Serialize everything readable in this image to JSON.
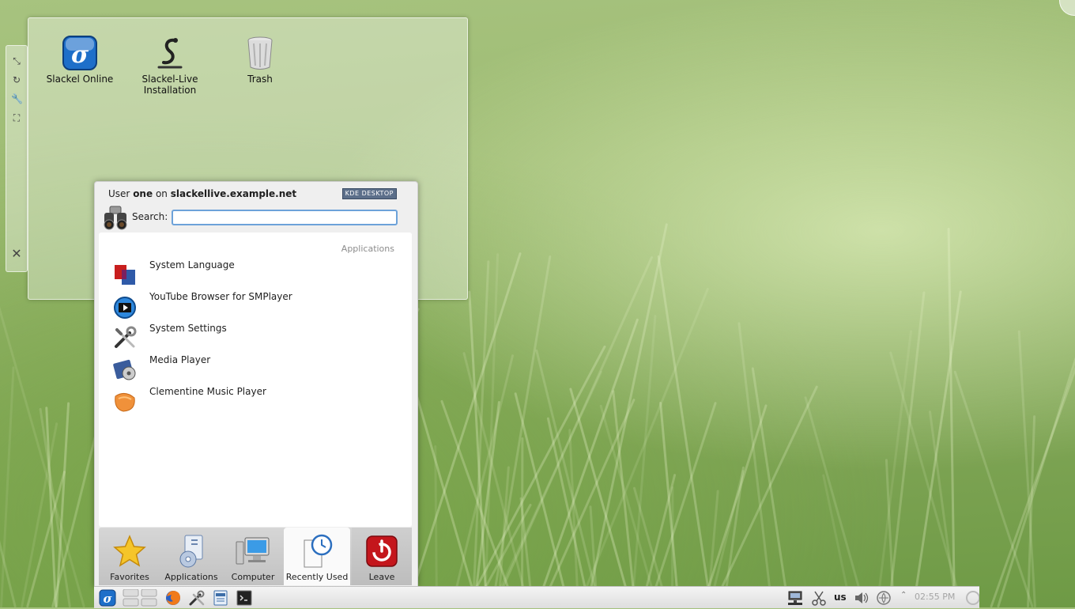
{
  "desktop": {
    "icons": [
      {
        "label_line1": "Slackel Online",
        "label_line2": ""
      },
      {
        "label_line1": "Slackel-Live",
        "label_line2": "Installation"
      },
      {
        "label_line1": "Trash",
        "label_line2": ""
      }
    ]
  },
  "launcher": {
    "header": {
      "prefix": "User",
      "user": "one",
      "mid": "on",
      "host": "slackellive.example.net"
    },
    "badge": "KDE DESKTOP",
    "search_label": "Search:",
    "search_value": "",
    "section": "Applications",
    "items": [
      {
        "label": "System Language",
        "icon": "flag-icon"
      },
      {
        "label": "YouTube Browser for SMPlayer",
        "icon": "smplayer-icon"
      },
      {
        "label": "System Settings",
        "icon": "tools-icon"
      },
      {
        "label": "Media Player",
        "icon": "media-player-icon"
      },
      {
        "label": "Clementine Music Player",
        "icon": "clementine-icon"
      }
    ],
    "tabs": [
      {
        "label": "Favorites"
      },
      {
        "label": "Applications"
      },
      {
        "label": "Computer"
      },
      {
        "label": "Recently Used"
      },
      {
        "label": "Leave"
      }
    ]
  },
  "panel": {
    "keyboard_layout": "us",
    "clock": "02:55 PM"
  },
  "colors": {
    "accent_blue": "#1e6fc9",
    "leave_red": "#c4161c",
    "search_border": "#6da2d9"
  }
}
